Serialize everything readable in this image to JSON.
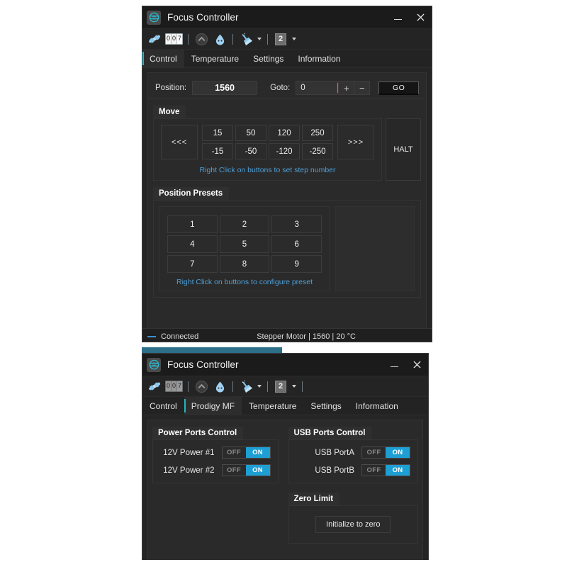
{
  "window1": {
    "title": "Focus Controller",
    "app_icon": "focus-controller-logo-icon",
    "titlebar_buttons": {
      "minimize": "minimize-icon",
      "close": "close-icon"
    },
    "toolbar": {
      "connect_icon": "plug-connector-icon",
      "counter_digits": [
        "0",
        "0",
        "7"
      ],
      "collapse_icon": "chevron-up-circle-icon",
      "drop_icon": "water-drop-icon",
      "clean_icon": "broom-icon",
      "clean_caret": "chevron-down-icon",
      "number_box": "2",
      "number_caret": "chevron-down-icon"
    },
    "tabs": [
      {
        "label": "Control",
        "active": true
      },
      {
        "label": "Temperature",
        "active": false
      },
      {
        "label": "Settings",
        "active": false
      },
      {
        "label": "Information",
        "active": false
      }
    ],
    "position_bar": {
      "position_label": "Position:",
      "position_value": "1560",
      "goto_label": "Goto:",
      "goto_value": "0",
      "goto_placeholder": "0",
      "plus_label": "+",
      "minus_label": "−",
      "go_label": "GO"
    },
    "move_group": {
      "title": "Move",
      "back_label": "<<<",
      "forward_label": ">>>",
      "steps_positive": [
        "15",
        "50",
        "120",
        "250"
      ],
      "steps_negative": [
        "-15",
        "-50",
        "-120",
        "-250"
      ],
      "hint": "Right Click on buttons to set step number",
      "halt_label": "HALT"
    },
    "presets_group": {
      "title": "Position Presets",
      "buttons": [
        "1",
        "2",
        "3",
        "4",
        "5",
        "6",
        "7",
        "8",
        "9"
      ],
      "hint": "Right Click on buttons to configure preset"
    },
    "statusbar": {
      "connection": "Connected",
      "details": "Stepper Motor | 1560 | 20 °C"
    }
  },
  "window2": {
    "title": "Focus Controller",
    "app_icon": "focus-controller-logo-icon",
    "titlebar_buttons": {
      "minimize": "minimize-icon",
      "close": "close-icon"
    },
    "toolbar": {
      "connect_icon": "plug-connector-icon",
      "counter_digits": [
        "0",
        "0",
        "7"
      ],
      "collapse_icon": "chevron-up-circle-icon",
      "drop_icon": "water-drop-icon",
      "clean_icon": "broom-icon",
      "clean_caret": "chevron-down-icon",
      "number_box": "2",
      "number_caret": "chevron-down-icon"
    },
    "tabs": [
      {
        "label": "Control",
        "active": false
      },
      {
        "label": "Prodigy MF",
        "active": true
      },
      {
        "label": "Temperature",
        "active": false
      },
      {
        "label": "Settings",
        "active": false
      },
      {
        "label": "Information",
        "active": false
      }
    ],
    "power_group": {
      "title": "Power Ports Control",
      "rows": [
        {
          "label": "12V Power #1",
          "off": "OFF",
          "on": "ON",
          "state": "ON"
        },
        {
          "label": "12V Power #2",
          "off": "OFF",
          "on": "ON",
          "state": "ON"
        }
      ]
    },
    "usb_group": {
      "title": "USB Ports Control",
      "rows": [
        {
          "label": "USB PortA",
          "off": "OFF",
          "on": "ON",
          "state": "ON"
        },
        {
          "label": "USB PortB",
          "off": "OFF",
          "on": "ON",
          "state": "ON"
        }
      ]
    },
    "zero_group": {
      "title": "Zero Limit",
      "button_label": "Initialize to zero"
    }
  },
  "colors": {
    "accent_teal": "#23b6c4",
    "toggle_on_blue": "#1d9fd4",
    "hint_blue": "#4e9fd6",
    "status_dash_blue": "#3f8fd0",
    "window_bg": "#252525",
    "panel_bg": "#2a2a2a",
    "titlebar_bg": "#1b1b1b"
  }
}
